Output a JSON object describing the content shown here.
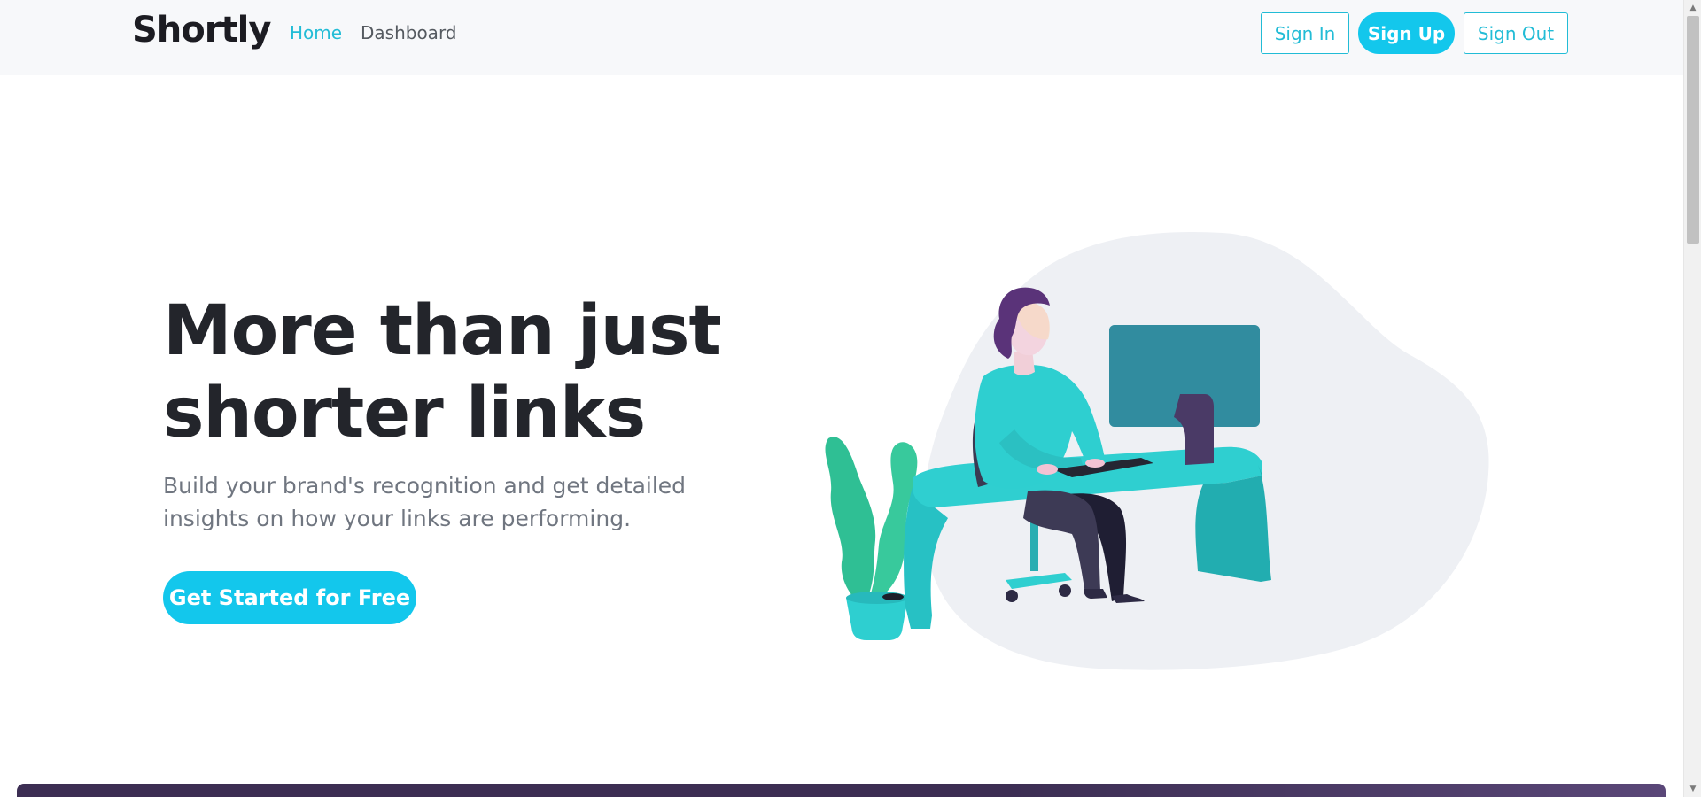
{
  "nav": {
    "brand": "Shortly",
    "links": [
      {
        "label": "Home",
        "active": true
      },
      {
        "label": "Dashboard",
        "active": false
      }
    ],
    "buttons": {
      "sign_in": "Sign In",
      "sign_up": "Sign Up",
      "sign_out": "Sign Out"
    }
  },
  "hero": {
    "title_line1": "More than just",
    "title_line2": "shorter links",
    "subtitle_line1": "Build your brand's recognition and get detailed",
    "subtitle_line2": "insights on how your links are performing.",
    "cta_label": "Get Started for Free"
  },
  "icons": {
    "illustration": "person-working-at-desk-illustration",
    "scroll_up": "scroll-up-arrow-icon",
    "scroll_down": "scroll-down-arrow-icon"
  },
  "colors": {
    "accent": "#13c7ec",
    "link_active": "#22bcd6",
    "heading": "#23252b",
    "subtext": "#707680",
    "promo_band": "#3c2e53"
  }
}
